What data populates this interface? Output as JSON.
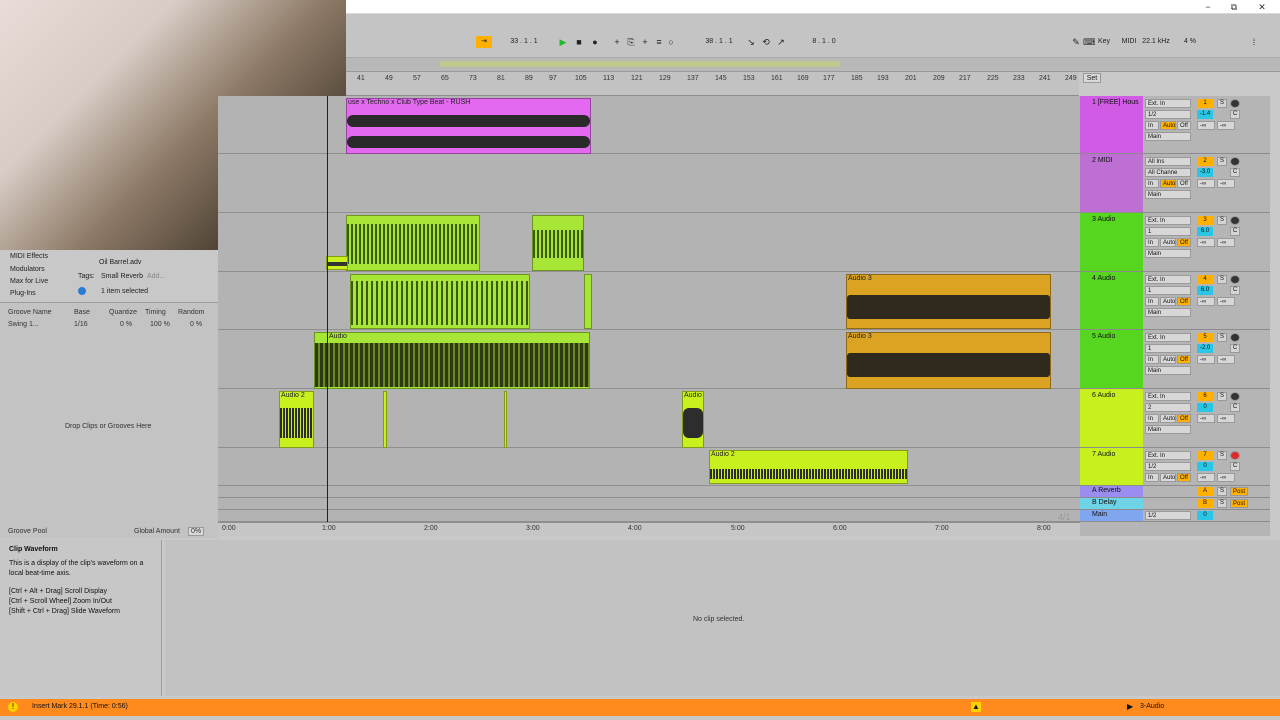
{
  "window": {
    "minimize": "−",
    "restore": "⧉",
    "close": "✕"
  },
  "transport": {
    "arrangement_position": "33 .   1 .   1",
    "loop_start": "38 .   1 .   1",
    "loop_length": "8 .   1 .   0",
    "key_label": "Key",
    "midi_label": "MIDI",
    "sample_rate": "22.1 kHz",
    "cpu": "4 %"
  },
  "ruler": {
    "bars": [
      "41",
      "49",
      "57",
      "65",
      "73",
      "81",
      "89",
      "97",
      "105",
      "113",
      "121",
      "129",
      "137",
      "145",
      "153",
      "161",
      "169",
      "177",
      "185",
      "193",
      "201",
      "209",
      "217",
      "225",
      "233",
      "241",
      "249"
    ],
    "set_label": "Set"
  },
  "timeline": {
    "labels": [
      "0:00",
      "1:00",
      "2:00",
      "3:00",
      "4:00",
      "5:00",
      "6:00",
      "7:00",
      "8:00"
    ],
    "signature": "4/1"
  },
  "clips": {
    "track1": "use x Techno x Club Type Beat - RUSH",
    "audio3_a": "Audio 3",
    "audio3_b": "Audio 3",
    "audio_c": "Audio",
    "audio2_a": "Audio 2",
    "audio_d": "Audio",
    "audio2_b": "Audio 2"
  },
  "tracks": [
    {
      "name": "1 [FREE] Hous",
      "input": "Ext. In",
      "channel": "1/2",
      "num": "1",
      "vol": "-1.4",
      "color": "#d25be6"
    },
    {
      "name": "2 MIDI",
      "input": "All Ins",
      "channel": "All Channe",
      "num": "2",
      "vol": "-3.0",
      "color": "#bd6fd3"
    },
    {
      "name": "3 Audio",
      "input": "Ext. In",
      "channel": "1",
      "num": "3",
      "vol": "6.0",
      "color": "#56d61f"
    },
    {
      "name": "4 Audio",
      "input": "Ext. In",
      "channel": "1",
      "num": "4",
      "vol": "6.0",
      "color": "#56d61f"
    },
    {
      "name": "5 Audio",
      "input": "Ext. In",
      "channel": "1",
      "num": "5",
      "vol": "-2.0",
      "color": "#56d61f"
    },
    {
      "name": "6 Audio",
      "input": "Ext. In",
      "channel": "2",
      "num": "6",
      "vol": "0",
      "color": "#c8f01e"
    },
    {
      "name": "7 Audio",
      "input": "Ext. In",
      "channel": "1/2",
      "num": "7",
      "vol": "0",
      "color": "#c8f01e"
    }
  ],
  "returns": [
    {
      "name": "A Reverb",
      "letter": "A",
      "post": "Post",
      "color": "#9b8cf0"
    },
    {
      "name": "B Delay",
      "letter": "B",
      "post": "Post",
      "color": "#6fd3e8"
    }
  ],
  "main": {
    "name": "Main",
    "channel": "1/2",
    "vol": "0"
  },
  "track_labels": {
    "in": "In",
    "auto": "Auto",
    "off": "Off",
    "main": "Main",
    "s": "S",
    "c": "C",
    "inf": "-∞"
  },
  "browser": {
    "items": [
      "MIDI Effects",
      "Modulators",
      "Max for Live",
      "Plug-Ins"
    ],
    "file": "Oil Barrel.adv",
    "tags_label": "Tags:",
    "tag": "Small Reverb",
    "tag_add": "Add...",
    "selected": "1 item selected"
  },
  "groove": {
    "headers": [
      "Groove Name",
      "Base",
      "Quantize",
      "Timing",
      "Random"
    ],
    "row": {
      "name": "Swing 1...",
      "base": "1/16",
      "quantize": "0 %",
      "timing": "100 %",
      "random": "0 %"
    },
    "drop_hint": "Drop Clips or Grooves Here",
    "pool_label": "Groove Pool",
    "global_label": "Global Amount",
    "global_value": "0%"
  },
  "info": {
    "title": "Clip Waveform",
    "desc": "This is a display of the clip's waveform on a local beat-time axis.",
    "lines": [
      "[Ctrl + Alt + Drag] Scroll Display",
      "[Ctrl + Scroll Wheel] Zoom In/Out",
      "[Shift + Ctrl + Drag] Slide Waveform"
    ]
  },
  "clipview": {
    "empty": "No clip selected."
  },
  "status": {
    "message": "Insert Mark 29.1.1 (Time: 0:56)",
    "track": "3-Audio"
  },
  "colors": {
    "accent": "#ffb000",
    "status": "#ff8a1e"
  }
}
